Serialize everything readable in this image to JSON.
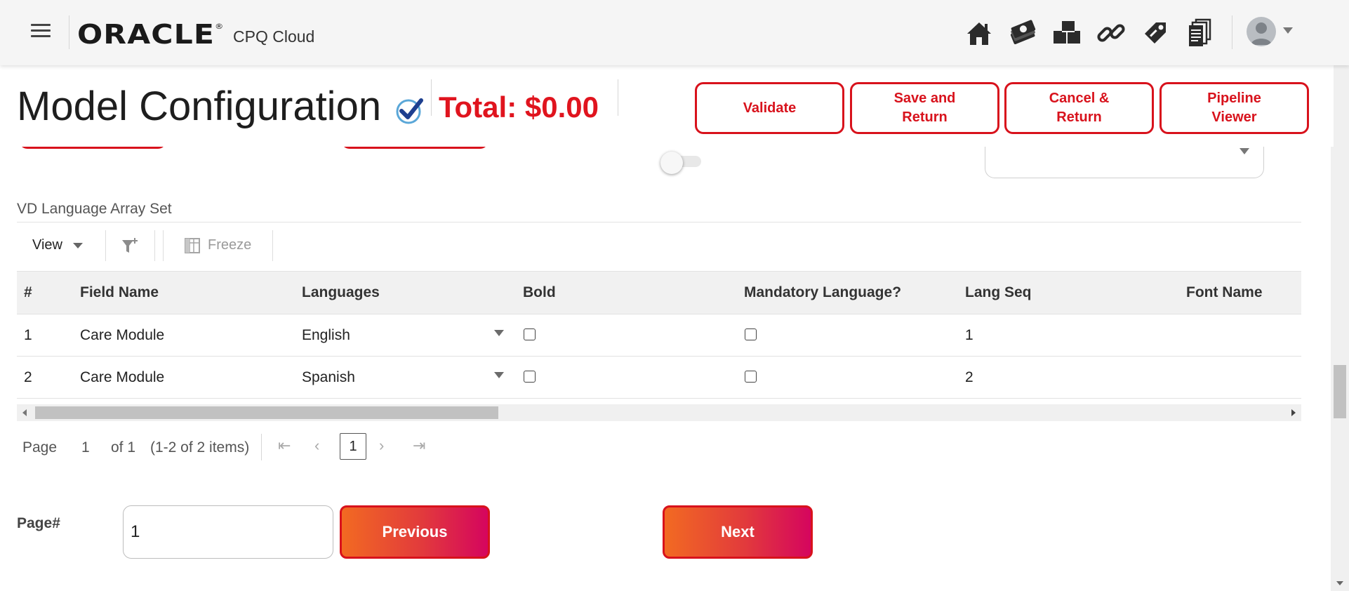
{
  "header": {
    "logo_text": "ORACLE",
    "logo_mark": "®",
    "product": "CPQ Cloud",
    "nav_icons": [
      "home-icon",
      "money-icon",
      "products-icon",
      "link-icon",
      "tag-icon",
      "documents-icon"
    ],
    "user": "user-avatar"
  },
  "titlebar": {
    "title": "Model Configuration",
    "total": "Total: $0.00",
    "buttons": {
      "validate": "Validate",
      "save_return": "Save and\nReturn",
      "cancel_return": "Cancel &\nReturn",
      "pipeline_viewer": "Pipeline\nViewer"
    }
  },
  "section": {
    "title": "VD Language Array Set",
    "toolbar": {
      "view": "View",
      "freeze": "Freeze"
    },
    "table": {
      "columns": [
        "#",
        "Field Name",
        "Languages",
        "Bold",
        "Mandatory Language?",
        "Lang Seq",
        "Font Name"
      ],
      "rows": [
        {
          "num": "1",
          "field_name": "Care Module",
          "language": "English",
          "bold": false,
          "mandatory": false,
          "lang_seq": "1",
          "font_name": ""
        },
        {
          "num": "2",
          "field_name": "Care Module",
          "language": "Spanish",
          "bold": false,
          "mandatory": false,
          "lang_seq": "2",
          "font_name": ""
        }
      ]
    },
    "pager": {
      "page_label": "Page",
      "page": "1",
      "of_label": "of 1",
      "items": "(1-2 of 2 items)",
      "current": "1"
    }
  },
  "paging": {
    "label": "Page#",
    "value": "1",
    "previous": "Previous",
    "next": "Next"
  },
  "colors": {
    "accent_red": "#d8121c",
    "gradient_start": "#f26a22",
    "gradient_end": "#d5055e"
  }
}
